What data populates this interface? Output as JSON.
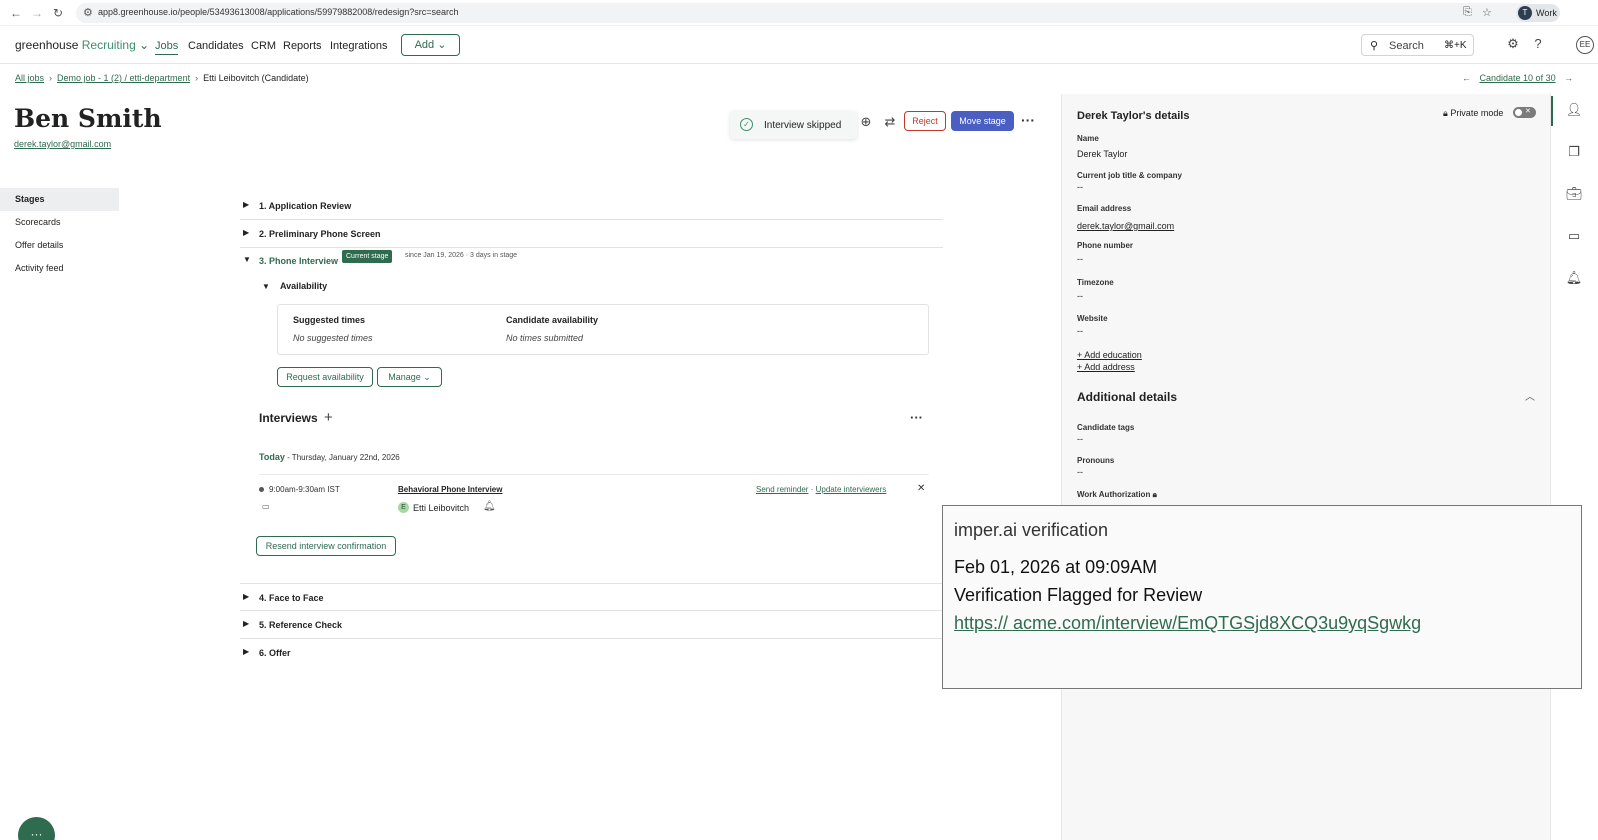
{
  "browser": {
    "url": "app8.greenhouse.io/people/53493613008/applications/59979882008/redesign?src=search",
    "profile_initial": "T",
    "profile_label": "Work"
  },
  "appnav": {
    "logo_main": "greenhouse",
    "logo_sub": "Recruiting",
    "items": [
      "Jobs",
      "Candidates",
      "CRM",
      "Reports",
      "Integrations"
    ],
    "add_label": "Add",
    "search_label": "Search",
    "search_shortcut": "⌘+K",
    "user_initials": "EE"
  },
  "breadcrumb": {
    "all_jobs": "All jobs",
    "job": "Demo job - 1 (2) / etti-department",
    "current": "Etti Leibovitch (Candidate)",
    "candidate_nav": "Candidate 10 of 30"
  },
  "candidate": {
    "name": "Ben Smith",
    "email": "derek.taylor@gmail.com"
  },
  "header": {
    "toast": "Interview skipped",
    "reject": "Reject",
    "move_stage": "Move stage"
  },
  "sidebar": {
    "items": [
      "Stages",
      "Scorecards",
      "Offer details",
      "Activity feed"
    ]
  },
  "stages": {
    "s1": "1. Application Review",
    "s2": "2. Preliminary Phone Screen",
    "s3": "3. Phone Interview",
    "current_badge": "Current stage",
    "since": "since Jan 19, 2026  ·  3 days in stage",
    "s4": "4. Face to Face",
    "s5": "5. Reference Check",
    "s6": "6. Offer"
  },
  "availability": {
    "heading": "Availability",
    "suggested_h": "Suggested times",
    "suggested_v": "No suggested times",
    "candidate_h": "Candidate availability",
    "candidate_v": "No times submitted",
    "request_btn": "Request availability",
    "manage_btn": "Manage"
  },
  "interviews": {
    "heading": "Interviews",
    "today": "Today",
    "date": " - Thursday, January 22nd, 2026",
    "time": "9:00am-9:30am IST",
    "title": "Behavioral Phone Interview",
    "interviewer_initial": "E",
    "interviewer": "Etti Leibovitch",
    "send_reminder": "Send reminder",
    "sep": " · ",
    "update_interviewers": "Update interviewers",
    "resend_btn": "Resend interview confirmation"
  },
  "details": {
    "title": "Derek Taylor's details",
    "private_mode": "Private mode",
    "name_label": "Name",
    "name_value": "Derek Taylor",
    "job_label": "Current job title & company",
    "job_value": "--",
    "email_label": "Email address",
    "email_value": "derek.taylor@gmail.com",
    "phone_label": "Phone number",
    "phone_value": "--",
    "tz_label": "Timezone",
    "tz_value": "--",
    "web_label": "Website",
    "web_value": "--",
    "add_education": "+ Add education",
    "add_address": "+ Add address",
    "additional": "Additional details",
    "tags_label": "Candidate tags",
    "tags_value": "--",
    "pronouns_label": "Pronouns",
    "pronouns_value": "--",
    "work_auth_label": "Work Authorization"
  },
  "overlay": {
    "title": "imper.ai verification",
    "date": "Feb 01, 2026 at 09:09AM",
    "status": "Verification Flagged for Review",
    "link": "https:// acme.com/interview/EmQTGSjd8XCQ3u9yqSgwkg"
  },
  "colors": {
    "brand_green": "#2f6b4f",
    "move_stage_blue": "#4a5fc1",
    "reject_red": "#c0392b"
  }
}
